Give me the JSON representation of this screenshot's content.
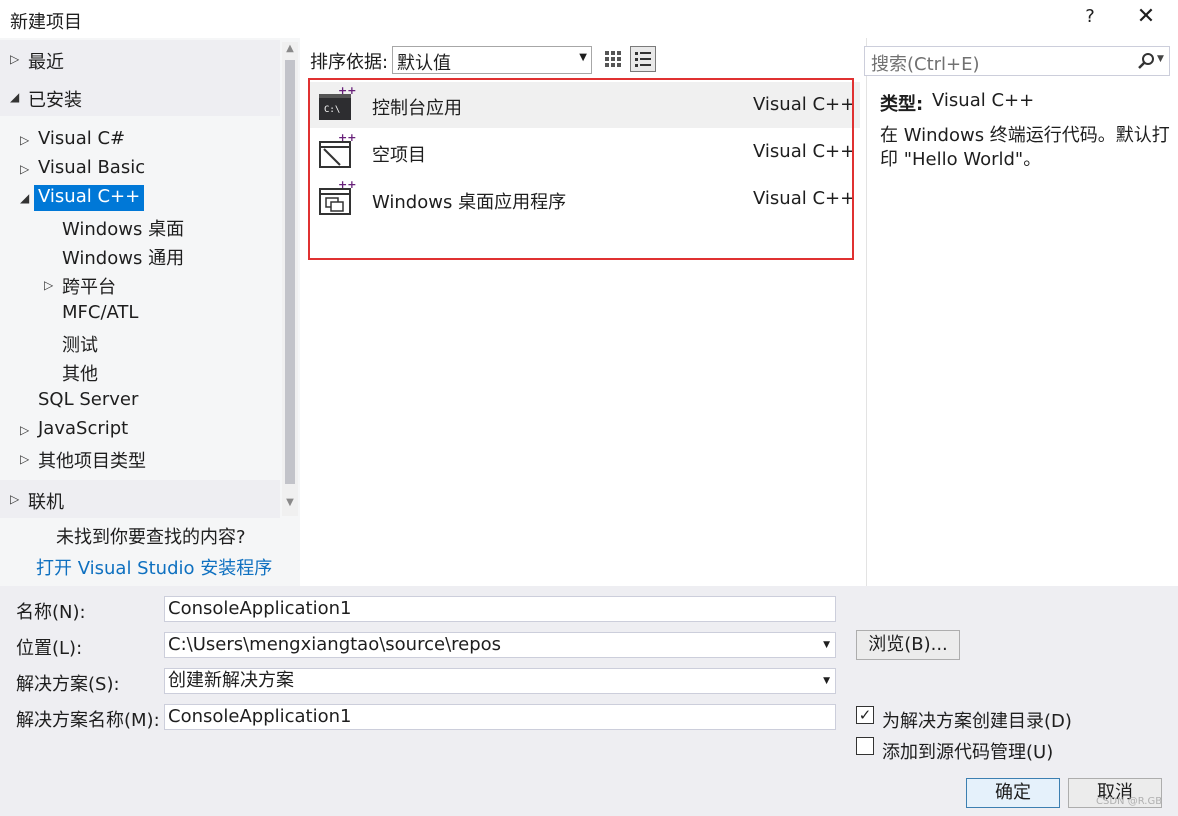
{
  "window": {
    "title": "新建项目",
    "help": "?",
    "close": "✕"
  },
  "left": {
    "recent": "最近",
    "installed": "已安装",
    "tree": [
      "Visual C#",
      "Visual Basic",
      "Visual C++",
      "Windows 桌面",
      "Windows 通用",
      "跨平台",
      "MFC/ATL",
      "测试",
      "其他",
      "SQL Server",
      "JavaScript",
      "其他项目类型"
    ],
    "online": "联机",
    "not_found": "未找到你要查找的内容?",
    "install_link": "打开 Visual Studio 安装程序"
  },
  "toolbar": {
    "sort_label": "排序依据:",
    "sort_value": "默认值"
  },
  "templates": [
    {
      "name": "控制台应用",
      "lang": "Visual C++",
      "icon": "console-app-icon"
    },
    {
      "name": "空项目",
      "lang": "Visual C++",
      "icon": "empty-project-icon"
    },
    {
      "name": "Windows 桌面应用程序",
      "lang": "Visual C++",
      "icon": "windows-desktop-app-icon"
    }
  ],
  "search": {
    "placeholder": "搜索(Ctrl+E)"
  },
  "details": {
    "type_label": "类型:",
    "type_value": "Visual C++",
    "description": "在 Windows 终端运行代码。默认打印 \"Hello World\"。"
  },
  "form": {
    "name_label": "名称(N):",
    "name_value": "ConsoleApplication1",
    "location_label": "位置(L):",
    "location_value": "C:\\Users\\mengxiangtao\\source\\repos",
    "browse": "浏览(B)...",
    "solution_label": "解决方案(S):",
    "solution_value": "创建新解决方案",
    "solution_name_label": "解决方案名称(M):",
    "solution_name_value": "ConsoleApplication1",
    "create_dir_label": "为解决方案创建目录(D)",
    "create_dir_checked": true,
    "add_scc_label": "添加到源代码管理(U)",
    "add_scc_checked": false,
    "ok": "确定",
    "cancel": "取消"
  },
  "watermark": "CSDN @R.GB",
  "colors": {
    "selection": "#0078d7",
    "link": "#0e70c0",
    "highlight_border": "#e03131"
  }
}
